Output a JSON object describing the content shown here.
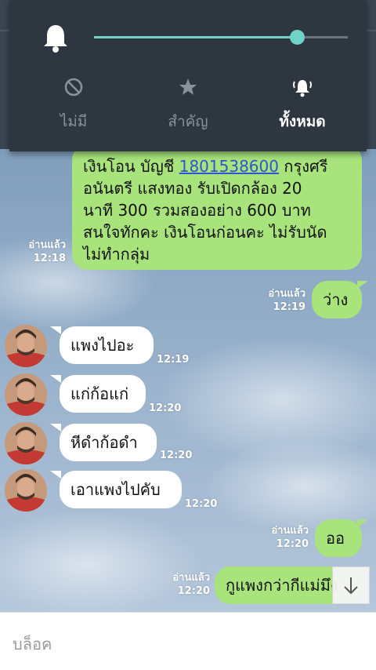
{
  "sound_panel": {
    "volume_level": 0.8,
    "modes": [
      {
        "label": "ไม่มี",
        "icon": "no-sound-icon",
        "active": false
      },
      {
        "label": "สำคัญ",
        "icon": "star-icon",
        "active": false
      },
      {
        "label": "ทั้งหมด",
        "icon": "bell-ringing-icon",
        "active": true
      }
    ]
  },
  "messages": [
    {
      "direction": "out",
      "text_before_link": "เงินโอน บัญชี ",
      "link": "1801538600",
      "text_lines": [
        "กรุงศรี",
        "อนันตรี แสงทอง รับเปิดกล้อง 20",
        "นาที 300 รวมสองอย่าง 600 บาท",
        "สนใจทักคะ เงินโอนก่อนคะ ไม่รับนัด",
        "ไม่ทำกลุ่ม"
      ],
      "read": "อ่านแล้ว",
      "time": "12:18"
    },
    {
      "direction": "out",
      "text": "ว่าง",
      "read": "อ่านแล้ว",
      "time": "12:19"
    },
    {
      "direction": "in",
      "text": "แพงไปอะ",
      "time": "12:19"
    },
    {
      "direction": "in",
      "text": "แก่ก้อแก่",
      "time": "12:20"
    },
    {
      "direction": "in",
      "text": "หีดำก้อดำ",
      "time": "12:20"
    },
    {
      "direction": "in",
      "text": "เอาแพงไปคับ",
      "time": "12:20"
    },
    {
      "direction": "out",
      "text": "ออ",
      "read": "อ่านแล้ว",
      "time": "12:20"
    },
    {
      "direction": "out",
      "text": "กูแพงกว่ากีแม่มึง",
      "read": "อ่านแล้ว",
      "time": "12:20"
    }
  ],
  "bottom_bar": {
    "block_label": "บล็อค"
  },
  "colors": {
    "bubble_out": "#a8e37b",
    "bubble_in": "#ffffff",
    "accent": "#6fd3c7",
    "link": "#2f55d4"
  }
}
